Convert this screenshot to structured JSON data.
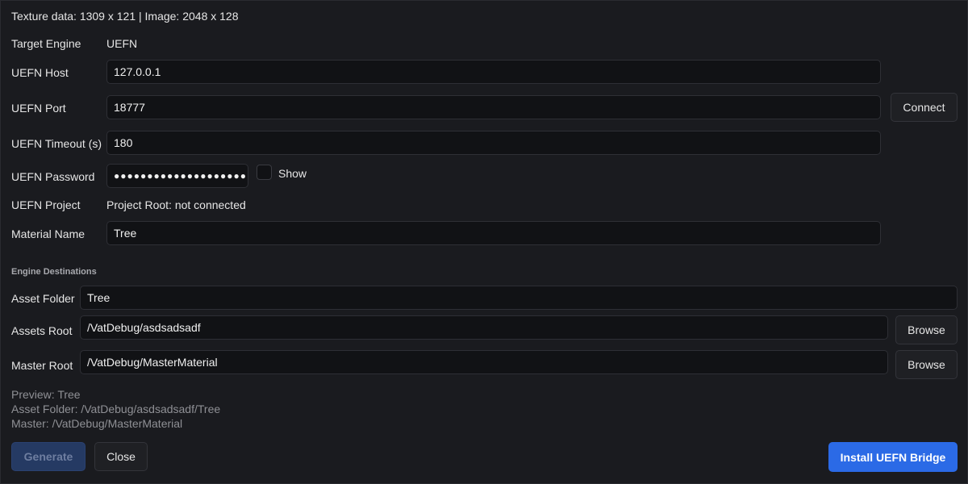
{
  "info": {
    "texture_summary": "Texture data: 1309 x 121 | Image: 2048 x 128"
  },
  "target_engine": {
    "label": "Target Engine",
    "value": "UEFN"
  },
  "host": {
    "label": "UEFN Host",
    "value": "127.0.0.1"
  },
  "port": {
    "label": "UEFN Port",
    "value": "18777",
    "connect_label": "Connect"
  },
  "timeout": {
    "label": "UEFN Timeout (s)",
    "value": "180"
  },
  "password": {
    "label": "UEFN Password",
    "masked_value": "●●●●●●●●●●●●●●●●●●●●",
    "show_label": "Show",
    "show_checked": false
  },
  "project": {
    "label": "UEFN Project",
    "value": "Project Root: not connected"
  },
  "material": {
    "label": "Material Name",
    "value": "Tree"
  },
  "destinations": {
    "section_title": "Engine Destinations",
    "asset_folder": {
      "label": "Asset Folder",
      "value": "Tree"
    },
    "assets_root": {
      "label": "Assets Root",
      "value": "/VatDebug/asdsadsadf",
      "browse_label": "Browse"
    },
    "master_root": {
      "label": "Master Root",
      "value": "/VatDebug/MasterMaterial",
      "browse_label": "Browse"
    }
  },
  "preview": {
    "line1": "Preview: Tree",
    "line2": "Asset Folder: /VatDebug/asdsadsadf/Tree",
    "line3": "Master: /VatDebug/MasterMaterial"
  },
  "actions": {
    "generate_label": "Generate",
    "close_label": "Close",
    "install_label": "Install UEFN Bridge"
  },
  "colors": {
    "background": "#1a1b1f",
    "field_background": "#111215",
    "accent": "#2b6ae6",
    "disabled_accent": "#253a63"
  }
}
